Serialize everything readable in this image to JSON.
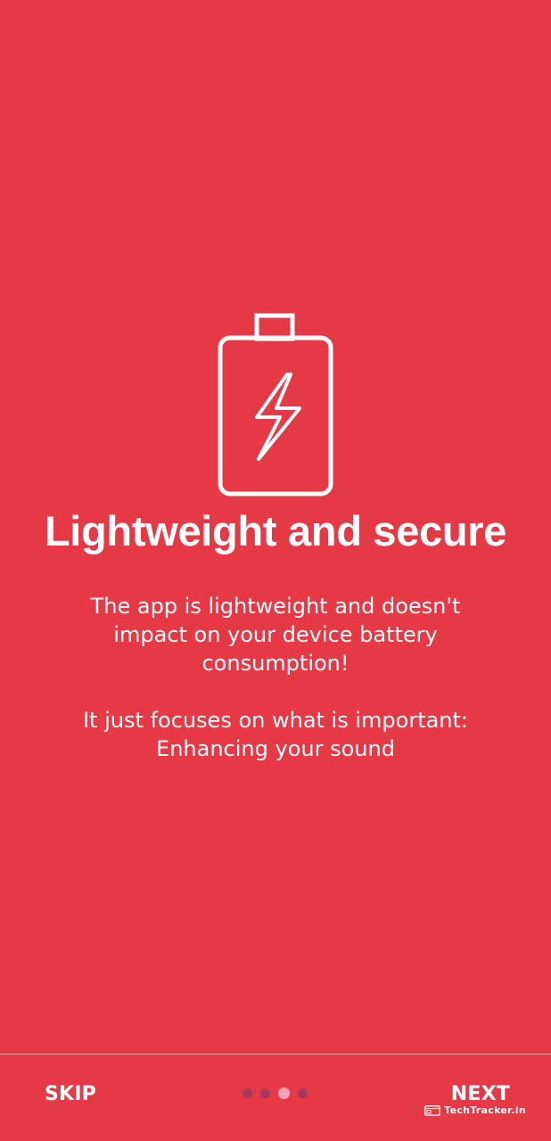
{
  "onboarding": {
    "title": "Lightweight and secure",
    "paragraph_1": "The app is lightweight and doesn't impact on your device battery consumption!",
    "paragraph_2": "It just focuses on what is important: Enhancing your sound",
    "icon": "battery-charging-icon"
  },
  "navigation": {
    "skip_label": "SKIP",
    "next_label": "NEXT",
    "page_count": 4,
    "current_page": 3
  },
  "watermark": {
    "text": "TechTracker.in"
  },
  "colors": {
    "background": "#e63946",
    "foreground": "#ffffff",
    "dot_inactive": "#a33a5a",
    "dot_active": "#f3a3b7"
  }
}
